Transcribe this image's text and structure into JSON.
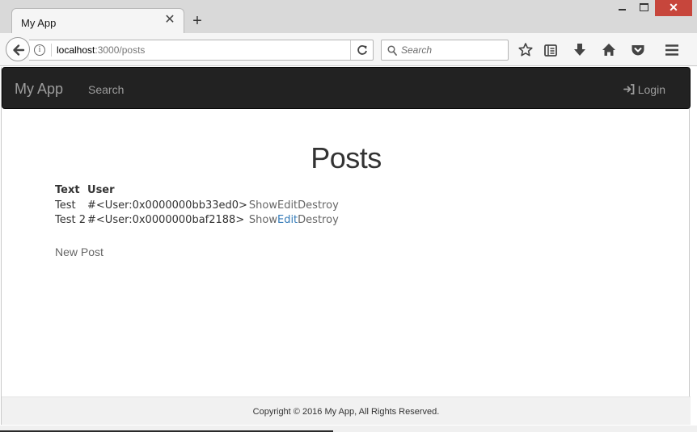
{
  "browser": {
    "tab_title": "My App",
    "tab_close": "✕",
    "new_tab": "+",
    "window_close": "✕",
    "url_host": "localhost",
    "url_path": ":3000/posts",
    "search_placeholder": "Search"
  },
  "navbar": {
    "brand": "My App",
    "search_link": "Search",
    "login_link": "Login"
  },
  "page": {
    "title": "Posts",
    "table": {
      "headers": [
        "Text",
        "User"
      ],
      "rows": [
        {
          "text": "Test",
          "user": "#<User:0x0000000bb33ed0>",
          "show": "Show",
          "edit": "Edit",
          "destroy": "Destroy"
        },
        {
          "text": "Test 2",
          "user": "#<User:0x0000000baf2188>",
          "show": "Show",
          "edit": "Edit",
          "destroy": "Destroy"
        }
      ]
    },
    "new_post": "New Post"
  },
  "footer": {
    "copyright": "Copyright © 2016 My App, All Rights Reserved."
  },
  "colors": {
    "navbar_bg": "#222222",
    "link_muted": "#666666",
    "link_accent": "#337ab7",
    "window_close": "#c7463c"
  }
}
